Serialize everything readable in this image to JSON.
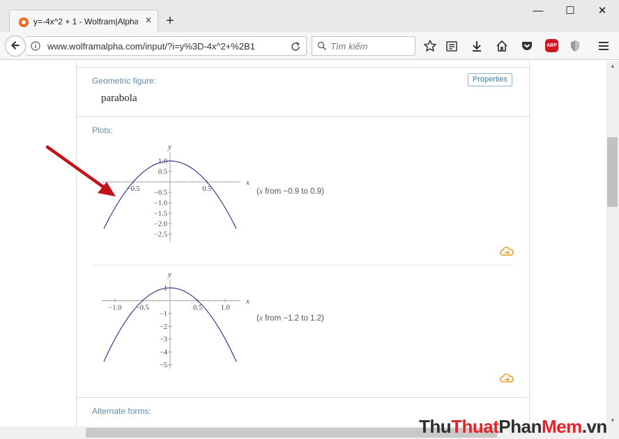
{
  "browser": {
    "tab_title": "y=-4x^2 + 1 - Wolfram|Alpha",
    "url": "www.wolframalpha.com/input/?i=y%3D-4x^2+%2B1",
    "search_placeholder": "Tìm kiếm",
    "abp_label": "ABP",
    "icons": [
      "wolfram-favicon",
      "close-icon",
      "plus-icon",
      "minimize-icon",
      "maximize-icon",
      "window-close-icon",
      "back-arrow-icon",
      "info-icon",
      "reload-icon",
      "search-icon",
      "star-icon",
      "reading-list-icon",
      "download-icon",
      "home-icon",
      "pocket-icon",
      "adblock-icon",
      "shield-icon",
      "hamburger-menu-icon"
    ]
  },
  "page": {
    "geometric_title": "Geometric figure:",
    "properties_label": "Properties",
    "geometric_value": "parabola",
    "plots_title": "Plots:",
    "plot1_range": "from −0.9 to 0.9",
    "plot2_range": "from −1.2 to 1.2",
    "range_var": "x",
    "alternate_title": "Alternate forms:"
  },
  "chart_data": [
    {
      "type": "line",
      "function": "y = -4x^2 + 1",
      "xlim": [
        -0.9,
        0.9
      ],
      "xlabel": "x",
      "ylabel": "y",
      "x_ticks": [
        "-0.5",
        "0.5"
      ],
      "y_ticks": [
        "1.0",
        "0.5",
        "-0.5",
        "-1.0",
        "-1.5",
        "-2.0",
        "-2.5"
      ],
      "line_color": "#3b3b8f"
    },
    {
      "type": "line",
      "function": "y = -4x^2 + 1",
      "xlim": [
        -1.2,
        1.2
      ],
      "xlabel": "x",
      "ylabel": "y",
      "x_ticks": [
        "-1.0",
        "-0.5",
        "0.5",
        "1.0"
      ],
      "y_ticks": [
        "1",
        "-1",
        "-2",
        "-3",
        "-4",
        "-5"
      ],
      "line_color": "#3b3b8f"
    }
  ],
  "watermark": {
    "part1": "Thu",
    "part2": "Thuat",
    "part3": "Phan",
    "part4": "Mem",
    "part5": ".vn"
  }
}
